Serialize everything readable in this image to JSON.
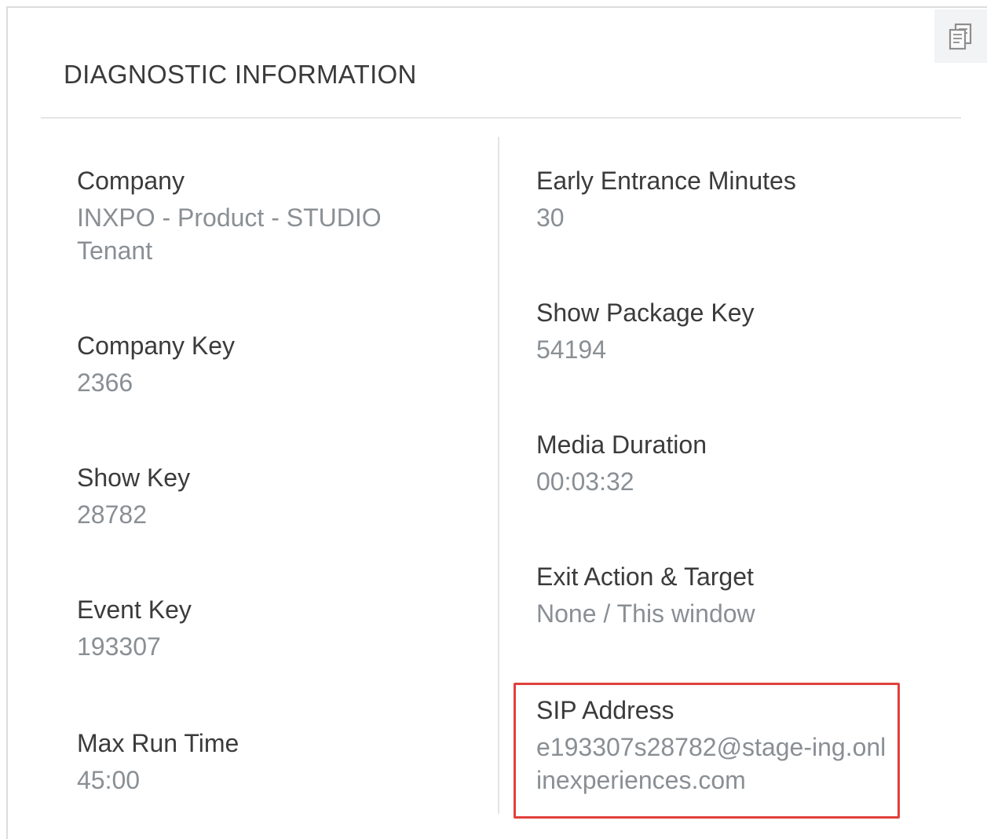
{
  "panel": {
    "title": "DIAGNOSTIC INFORMATION",
    "copy_icon": "copy-icon"
  },
  "left_column": [
    {
      "label": "Company",
      "value": "INXPO - Product - STUDIO Tenant"
    },
    {
      "label": "Company Key",
      "value": "2366"
    },
    {
      "label": "Show Key",
      "value": "28782"
    },
    {
      "label": "Event Key",
      "value": "193307"
    },
    {
      "label": "Max Run Time",
      "value": "45:00"
    }
  ],
  "right_column": [
    {
      "label": "Early Entrance Minutes",
      "value": "30"
    },
    {
      "label": "Show Package Key",
      "value": "54194"
    },
    {
      "label": "Media Duration",
      "value": "00:03:32"
    },
    {
      "label": "Exit Action & Target",
      "value": "None / This window"
    },
    {
      "label": "SIP Address",
      "value": "e193307s28782@stage-ing.onlinexperiences.com"
    }
  ],
  "colors": {
    "label": "#3b3b3b",
    "value": "#8a8f94",
    "highlight": "#e0403c"
  }
}
